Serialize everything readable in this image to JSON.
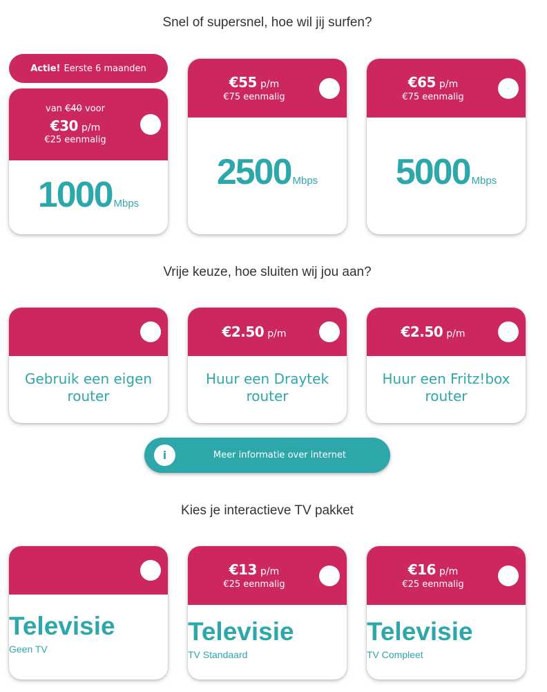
{
  "internet": {
    "title": "Snel of supersnel, hoe wil jij surfen?",
    "promo": {
      "bold": "Actie!",
      "text": "Eerste 6 maanden"
    },
    "options": [
      {
        "prefix": "van",
        "old_price": "€40",
        "suffix": "voor",
        "price": "€30",
        "unit": "p/m",
        "setup": "€25 eenmalig",
        "speed": "1000",
        "speed_unit": "Mbps"
      },
      {
        "price": "€55",
        "unit": "p/m",
        "setup": "€75 eenmalig",
        "speed": "2500",
        "speed_unit": "Mbps"
      },
      {
        "price": "€65",
        "unit": "p/m",
        "setup": "€75 eenmalig",
        "speed": "5000",
        "speed_unit": "Mbps"
      }
    ]
  },
  "router": {
    "title": "Vrije keuze, hoe sluiten wij jou aan?",
    "options": [
      {
        "label_1": "Gebruik een eigen",
        "label_2": "router"
      },
      {
        "price": "€2.50",
        "unit": "p/m",
        "label_1": "Huur een Draytek",
        "label_2": "router"
      },
      {
        "price": "€2.50",
        "unit": "p/m",
        "label_1": "Huur een Fritz!box",
        "label_2": "router"
      }
    ]
  },
  "info_button": {
    "icon": "i",
    "label": "Meer informatie over internet"
  },
  "tv": {
    "title": "Kies je interactieve TV pakket",
    "options": [
      {
        "name": "Televisie",
        "package": "Geen TV"
      },
      {
        "price": "€13",
        "unit": "p/m",
        "setup": "€25 eenmalig",
        "name": "Televisie",
        "package": "TV Standaard"
      },
      {
        "price": "€16",
        "unit": "p/m",
        "setup": "€25 eenmalig",
        "name": "Televisie",
        "package": "TV Compleet"
      }
    ]
  },
  "colors": {
    "accent": "#cc2760",
    "teal": "#2ea7ab",
    "text": "#333333"
  }
}
